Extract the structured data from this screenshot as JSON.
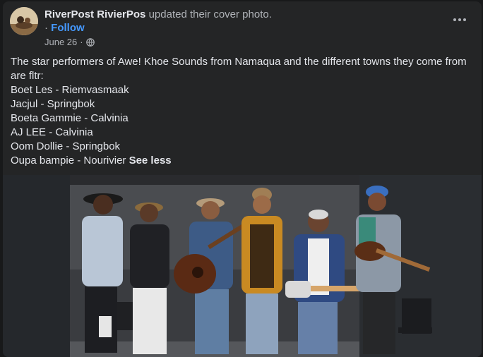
{
  "post": {
    "author": "RiverPost RivierPos",
    "action": "updated their cover photo.",
    "follow_label": "Follow",
    "follow_separator": "·",
    "date": "June 26",
    "meta_separator": "·",
    "audience_icon": "globe-icon",
    "more_icon": "more-horizontal-icon",
    "intro": "The star performers of Awe! Khoe Sounds from Namaqua and the different towns they come from are fltr:",
    "performers": [
      "Boet Les - Riemvasmaak",
      "Jacjul - Springbok",
      "Boeta Gammie - Calvinia",
      "AJ LEE - Calvinia",
      "Oom Dollie - Springbok",
      "Oupa bampie - Nourivier"
    ],
    "see_less_label": "See less"
  },
  "colors": {
    "page_bg": "#18191a",
    "card_bg": "#242526",
    "primary_text": "#e4e6eb",
    "secondary_text": "#b0b3b8",
    "link_blue": "#4599ff"
  }
}
